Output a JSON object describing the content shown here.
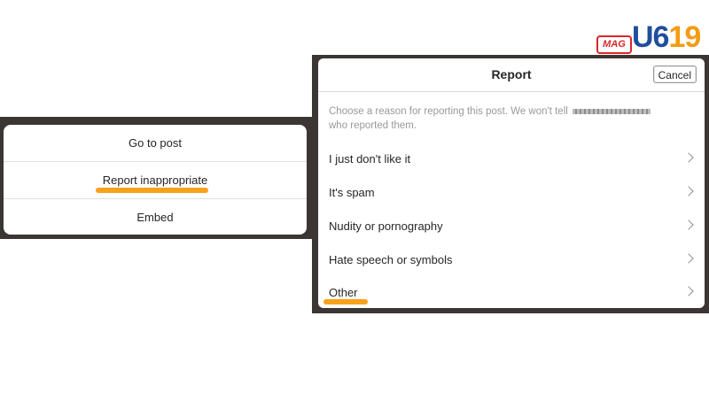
{
  "logo": {
    "mag": "MAG",
    "word_part1": "U6",
    "word_part2": "19",
    "colors": {
      "mag": "#d9262a",
      "part1": "#1f4e9c",
      "part2": "#f39c12"
    }
  },
  "options_sheet": {
    "items": [
      {
        "label": "Go to post"
      },
      {
        "label": "Report inappropriate",
        "highlighted": true
      },
      {
        "label": "Embed"
      }
    ]
  },
  "report_dialog": {
    "title": "Report",
    "cancel_label": "Cancel",
    "description": "Choose a reason for reporting this post. We won't tell",
    "description_end": "who reported them.",
    "reasons": [
      {
        "label": "I just don't like it"
      },
      {
        "label": "It's spam"
      },
      {
        "label": "Nudity or pornography"
      },
      {
        "label": "Hate speech or symbols"
      },
      {
        "label": "Other",
        "highlighted": true
      }
    ]
  },
  "colors": {
    "highlight": "#f7a21b",
    "backdrop": "#3b3634",
    "text": "#262626",
    "muted_text": "#999999"
  }
}
